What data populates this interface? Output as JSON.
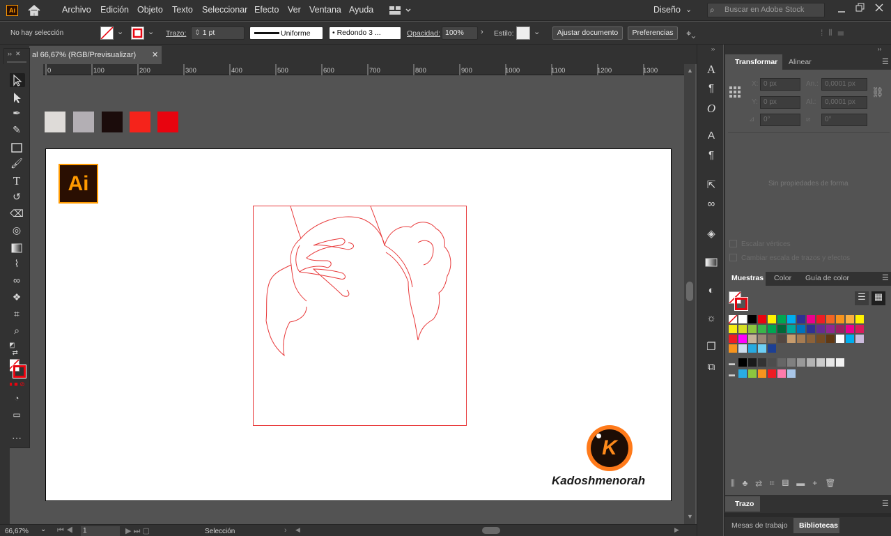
{
  "menubar": {
    "app_badge": "Ai",
    "items": [
      "Archivo",
      "Edición",
      "Objeto",
      "Texto",
      "Seleccionar",
      "Efecto",
      "Ver",
      "Ventana",
      "Ayuda"
    ],
    "workspace": "Diseño",
    "search_placeholder": "Buscar en Adobe Stock"
  },
  "controlbar": {
    "selection": "No hay selección",
    "stroke_label": "Trazo:",
    "stroke_weight": "1 pt",
    "stroke_style": "Uniforme",
    "brush": "Redondo 3 ...",
    "opacity_label": "Opacidad:",
    "opacity_value": "100%",
    "style_label": "Estilo:",
    "adjust_doc": "Ajustar documento",
    "preferences": "Preferencias"
  },
  "document": {
    "tab_title": "al 66,67% (RGB/Previsualizar)",
    "zoom": "66,67%",
    "artboard_num": "1",
    "status_tool": "Selección"
  },
  "ruler": {
    "ticks": [
      "0",
      "100",
      "200",
      "300",
      "400",
      "500",
      "600",
      "700",
      "800",
      "900",
      "1000",
      "1100",
      "1200",
      "1300"
    ]
  },
  "canvas": {
    "swatch_colors": [
      "#dedbd8",
      "#b3afb4",
      "#1b0c0b",
      "#f5231b",
      "#e8040f"
    ],
    "logo_text": "Ai",
    "watermark": "Kadoshmenorah",
    "watermark_letter": "K",
    "line_color": "#e8393a"
  },
  "transform_panel": {
    "tabs": [
      "Transformar",
      "Alinear"
    ],
    "x_label": "X:",
    "x_value": "0 px",
    "y_label": "Y:",
    "y_value": "0 px",
    "w_label": "An.:",
    "w_value": "0,0001 px",
    "h_label": "Al.:",
    "h_value": "0,0001 px",
    "angle1": "0°",
    "angle2": "0°",
    "empty_msg": "Sin propiedades de forma",
    "check1": "Escalar vértices",
    "check2": "Cambiar escala de trazos y efectos"
  },
  "swatches_panel": {
    "tabs": [
      "Muestras",
      "Color",
      "Guía de color"
    ]
  },
  "stroke_panel": {
    "title": "Trazo"
  },
  "bottom_panel": {
    "tabs": [
      "Mesas de trabajo",
      "Bibliotecas"
    ]
  }
}
